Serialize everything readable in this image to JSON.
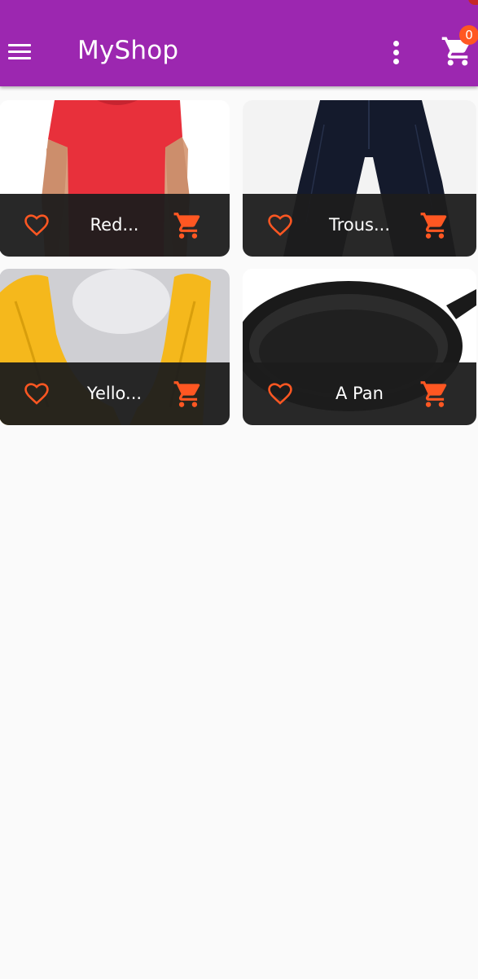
{
  "appbar": {
    "title": "MyShop",
    "cart_count": "0",
    "background_color": "#9c27b0",
    "badge_color": "#ff5722"
  },
  "products": [
    {
      "name": "Red...",
      "image": "red-t-shirt",
      "favorite": false
    },
    {
      "name": "Trous...",
      "image": "dark-trousers",
      "favorite": false
    },
    {
      "name": "Yello...",
      "image": "yellow-scarf",
      "favorite": false
    },
    {
      "name": "A Pan",
      "image": "cast-iron-pan",
      "favorite": false
    }
  ],
  "icons": {
    "menu": "menu-icon",
    "more": "more-vert-icon",
    "cart": "shopping-cart-icon",
    "favorite": "favorite-border-icon",
    "add_to_cart": "add-shopping-cart-icon"
  },
  "accent_color": "#ff5722"
}
